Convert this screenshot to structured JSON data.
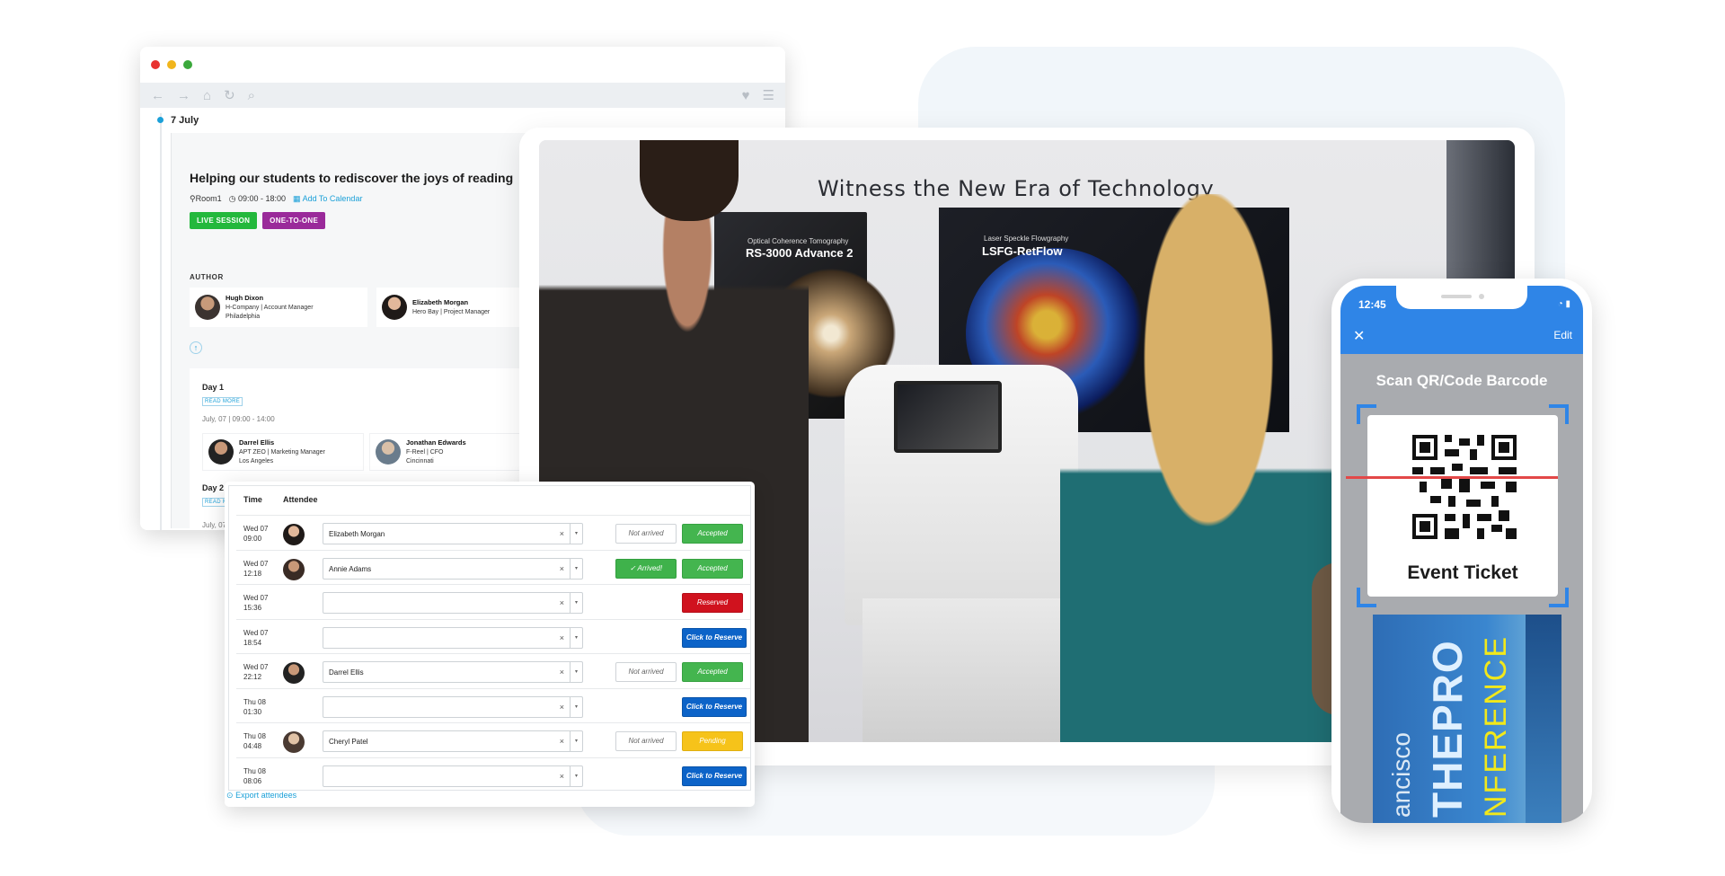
{
  "browser": {
    "timeline_date": "7 July",
    "session": {
      "title": "Helping our students to rediscover the joys of reading",
      "room": "Room1",
      "time": "09:00 - 18:00",
      "add_to_calendar": "Add To Calendar",
      "tags": [
        "LIVE SESSION",
        "ONE-TO-ONE"
      ]
    },
    "author_heading": "AUTHOR",
    "authors": [
      {
        "name": "Hugh Dixon",
        "line1": "H-Company | Account Manager",
        "line2": "Philadelphia"
      },
      {
        "name": "Elizabeth Morgan",
        "line1": "Hero Bay | Project Manager",
        "line2": ""
      }
    ],
    "days": [
      {
        "label": "Day 1",
        "read_more": "READ MORE",
        "time": "July, 07 | 09:00 - 14:00"
      },
      {
        "label": "Day 2",
        "read_more": "READ MORE",
        "time": "July, 07"
      }
    ],
    "speakers": [
      {
        "name": "Darrel Ellis",
        "line1": "APT ZEO | Marketing Manager",
        "line2": "Los Angeles"
      },
      {
        "name": "Jonathan Edwards",
        "line1": "F-Reel | CFO",
        "line2": "Cincinnati"
      }
    ]
  },
  "attendee_table": {
    "col_time": "Time",
    "col_attendee": "Attendee",
    "rows": [
      {
        "day": "Wed 07",
        "time": "09:00",
        "name": "Elizabeth Morgan",
        "arrival": "Not arrived",
        "status": "Accepted"
      },
      {
        "day": "Wed 07",
        "time": "12:18",
        "name": "Annie Adams",
        "arrival": "✓ Arrived!",
        "status": "Accepted"
      },
      {
        "day": "Wed 07",
        "time": "15:36",
        "name": "",
        "arrival": "",
        "status": "Reserved"
      },
      {
        "day": "Wed 07",
        "time": "18:54",
        "name": "",
        "arrival": "",
        "status": "Click to Reserve"
      },
      {
        "day": "Wed 07",
        "time": "22:12",
        "name": "Darrel Ellis",
        "arrival": "Not arrived",
        "status": "Accepted"
      },
      {
        "day": "Thu 08",
        "time": "01:30",
        "name": "",
        "arrival": "",
        "status": "Click to Reserve"
      },
      {
        "day": "Thu 08",
        "time": "04:48",
        "name": "Cheryl Patel",
        "arrival": "Not arrived",
        "status": "Pending"
      },
      {
        "day": "Thu 08",
        "time": "08:06",
        "name": "",
        "arrival": "",
        "status": "Click to Reserve"
      }
    ],
    "export_label": "Export attendees",
    "clear_symbol": "×",
    "caret_symbol": "▾"
  },
  "video": {
    "heading": "Witness the New Era of Technology",
    "panel1_sub": "Optical Coherence Tomography",
    "panel1_title": "RS-3000 Advance 2",
    "panel2_sub": "Laser Speckle Flowgraphy",
    "panel2_title": "LSFG-RetFlow"
  },
  "phone": {
    "time": "12:45",
    "close_symbol": "✕",
    "edit_label": "Edit",
    "title": "Scan QR/Code Barcode",
    "ticket_label": "Event Ticket",
    "banner_city": "ancisco",
    "banner_main": "THEPRO",
    "banner_sub": "NFERENCE"
  },
  "colors": {
    "accent_blue": "#1ba0d8",
    "accepted_green": "#44b54f",
    "reserved_red": "#d0121e",
    "reserve_blue": "#0c63c8",
    "pending_yellow": "#f6c31a",
    "phone_blue": "#2f85e7"
  },
  "icons": {
    "browser_nav": [
      "back-arrow-icon",
      "forward-arrow-icon",
      "home-icon",
      "refresh-icon",
      "search-icon",
      "heart-icon",
      "menu-icon"
    ],
    "meta": [
      "location-pin-icon",
      "clock-icon",
      "calendar-icon"
    ],
    "phone": [
      "close-icon",
      "wifi-icon",
      "battery-icon",
      "qr-code-icon"
    ]
  }
}
